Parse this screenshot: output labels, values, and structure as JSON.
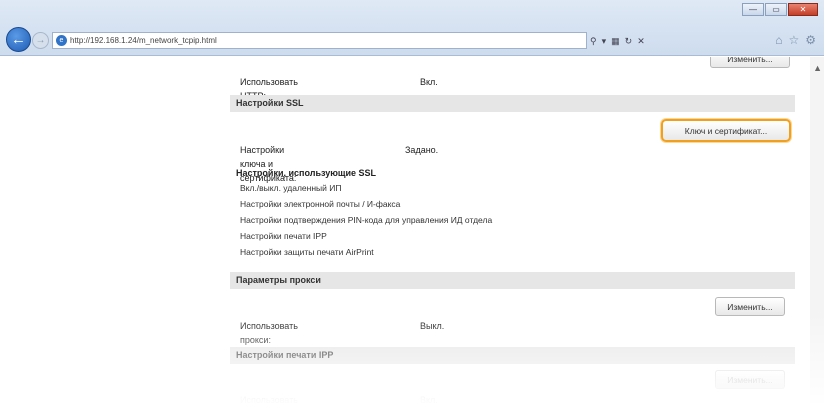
{
  "browser": {
    "url": "http://192.168.1.24/m_network_tcpip.html",
    "search_icon": "Ⲣ ▾ ⧉ ₢ ✕",
    "window_buttons": [
      "—",
      "▭",
      "✕"
    ]
  },
  "page": {
    "top_row": {
      "label": "Использовать HTTP:",
      "value": "Вкл.",
      "button": "Изменить..."
    },
    "ssl": {
      "title": "Настройки SSL",
      "key_button": "Ключ и сертификат...",
      "key_label": "Настройки ключа и сертификата:",
      "key_value": "Задано.",
      "subhead": "Настройки, использующие SSL",
      "items": [
        "Вкл./выкл. удаленный ИП",
        "Настройки электронной почты / И-факса",
        "Настройки подтверждения PIN-кода для управления ИД отдела",
        "Настройки печати IPP",
        "Настройки защиты печати AirPrint"
      ]
    },
    "proxy": {
      "title": "Параметры прокси",
      "button": "Изменить...",
      "label": "Использовать прокси:",
      "value": "Выкл."
    },
    "ipp": {
      "title": "Настройки печати IPP",
      "button": "Изменить...",
      "label": "Использовать печать IPP:",
      "value": "Вкл."
    }
  }
}
